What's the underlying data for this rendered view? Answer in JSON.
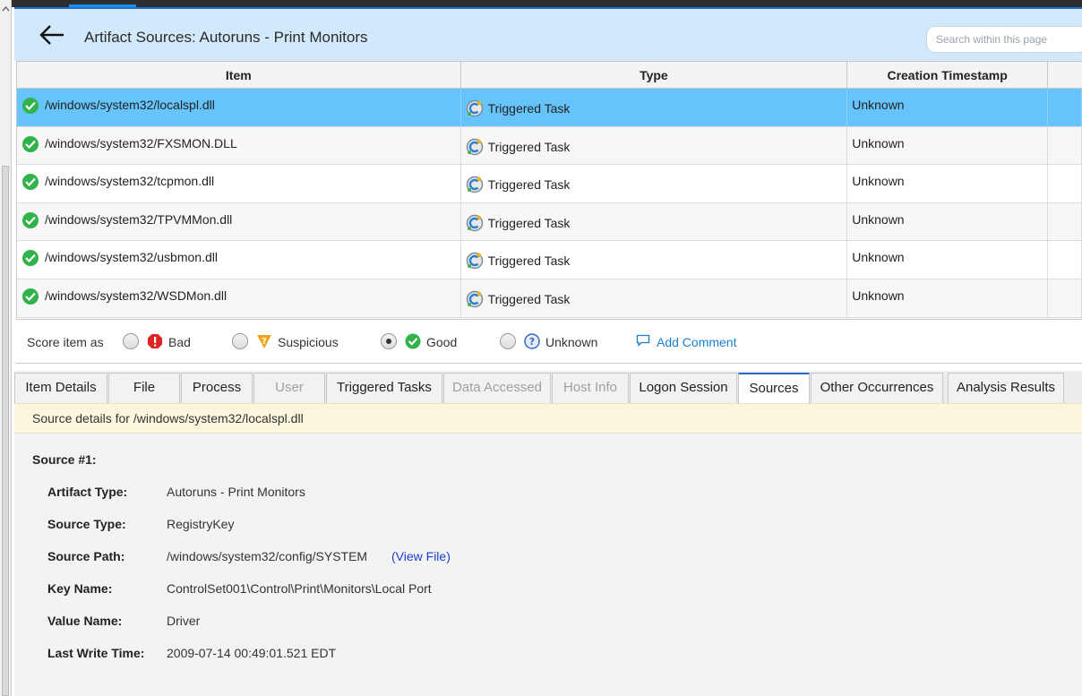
{
  "header": {
    "title": "Artifact Sources: Autoruns - Print Monitors",
    "search_placeholder": "Search within this page"
  },
  "table": {
    "columns": [
      "Item",
      "Type",
      "Creation Timestamp",
      ""
    ],
    "rows": [
      {
        "item": "/windows/system32/localspl.dll",
        "type": "Triggered Task",
        "timestamp": "Unknown",
        "selected": true
      },
      {
        "item": "/windows/system32/FXSMON.DLL",
        "type": "Triggered Task",
        "timestamp": "Unknown",
        "selected": false
      },
      {
        "item": "/windows/system32/tcpmon.dll",
        "type": "Triggered Task",
        "timestamp": "Unknown",
        "selected": false
      },
      {
        "item": "/windows/system32/TPVMMon.dll",
        "type": "Triggered Task",
        "timestamp": "Unknown",
        "selected": false
      },
      {
        "item": "/windows/system32/usbmon.dll",
        "type": "Triggered Task",
        "timestamp": "Unknown",
        "selected": false
      },
      {
        "item": "/windows/system32/WSDMon.dll",
        "type": "Triggered Task",
        "timestamp": "Unknown",
        "selected": false
      }
    ]
  },
  "score": {
    "label": "Score item as",
    "options": [
      {
        "label": "Bad",
        "icon": "bad-icon",
        "checked": false
      },
      {
        "label": "Suspicious",
        "icon": "suspicious-icon",
        "checked": false
      },
      {
        "label": "Good",
        "icon": "good-icon",
        "checked": true
      },
      {
        "label": "Unknown",
        "icon": "unknown-icon",
        "checked": false
      }
    ],
    "add_comment": "Add Comment"
  },
  "tabs": [
    {
      "label": "Item Details",
      "state": "normal"
    },
    {
      "label": "File",
      "state": "normal"
    },
    {
      "label": "Process",
      "state": "normal"
    },
    {
      "label": "User",
      "state": "disabled"
    },
    {
      "label": "Triggered Tasks",
      "state": "normal"
    },
    {
      "label": "Data Accessed",
      "state": "disabled"
    },
    {
      "label": "Host Info",
      "state": "disabled"
    },
    {
      "label": "Logon Session",
      "state": "normal"
    },
    {
      "label": "Sources",
      "state": "active"
    },
    {
      "label": "Other Occurrences",
      "state": "normal"
    },
    {
      "label": "Analysis Results",
      "state": "normal"
    }
  ],
  "details": {
    "banner": "Source details for /windows/system32/localspl.dll",
    "source_heading": "Source #1:",
    "fields": [
      {
        "label": "Artifact Type:",
        "value": "Autoruns - Print Monitors"
      },
      {
        "label": "Source Type:",
        "value": "RegistryKey"
      },
      {
        "label": "Source Path:",
        "value": "/windows/system32/config/SYSTEM"
      },
      {
        "label": "Key Name:",
        "value": "ControlSet001\\Control\\Print\\Monitors\\Local Port"
      },
      {
        "label": "Value Name:",
        "value": "Driver"
      },
      {
        "label": "Last Write Time:",
        "value": "2009-07-14 00:49:01.521 EDT"
      }
    ],
    "view_file": "(View File)"
  },
  "colors": {
    "header_bg": "#d2e8fb",
    "selected_row": "#66c4fb",
    "good": "#2fb34a",
    "bad": "#e02424",
    "suspicious": "#f2a51a",
    "unknown": "#3a66c8",
    "link": "#1a7fd4"
  }
}
